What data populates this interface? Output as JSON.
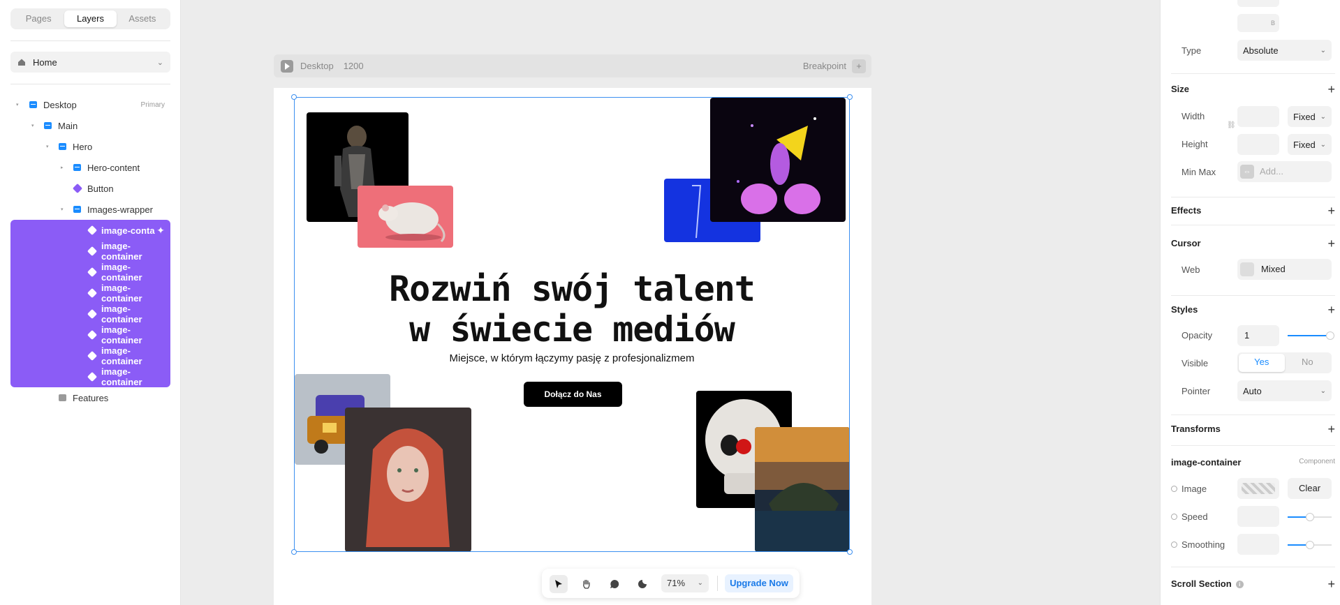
{
  "left_panel": {
    "tabs": [
      "Pages",
      "Layers",
      "Assets"
    ],
    "page_select": "Home",
    "layers": {
      "desktop": "Desktop",
      "desktop_badge": "Primary",
      "main": "Main",
      "hero": "Hero",
      "hero_content": "Hero-content",
      "button": "Button",
      "images_wrapper": "Images-wrapper",
      "image_items": [
        "image-conta",
        "image-container",
        "image-container",
        "image-container",
        "image-container",
        "image-container",
        "image-container",
        "image-container"
      ],
      "features": "Features"
    }
  },
  "canvas": {
    "breakpoint_name": "Desktop",
    "breakpoint_width": "1200",
    "breakpoint_label": "Breakpoint",
    "heading_line1": "Rozwiń swój talent",
    "heading_line2": "w świecie mediów",
    "subtitle": "Miejsce, w którym łączymy pasję z profesjonalizmem",
    "cta": "Dołącz do Nas"
  },
  "toolbar": {
    "zoom": "71%",
    "upgrade": "Upgrade Now"
  },
  "right_panel": {
    "b_label": "B",
    "type_label": "Type",
    "type_value": "Absolute",
    "size": "Size",
    "width_label": "Width",
    "width_mode": "Fixed",
    "height_label": "Height",
    "height_mode": "Fixed",
    "minmax_label": "Min Max",
    "minmax_placeholder": "Add...",
    "effects": "Effects",
    "cursor": "Cursor",
    "web_label": "Web",
    "web_value": "Mixed",
    "styles": "Styles",
    "opacity_label": "Opacity",
    "opacity_value": "1",
    "visible_label": "Visible",
    "visible_yes": "Yes",
    "visible_no": "No",
    "pointer_label": "Pointer",
    "pointer_value": "Auto",
    "transforms": "Transforms",
    "component_name": "image-container",
    "component_tag": "Component",
    "image_label": "Image",
    "clear": "Clear",
    "speed_label": "Speed",
    "smoothing_label": "Smoothing",
    "scroll_section": "Scroll Section"
  },
  "colors": {
    "accent": "#8b5cf6",
    "selection": "#3b8ff0",
    "brand_blue": "#1a8cff"
  }
}
